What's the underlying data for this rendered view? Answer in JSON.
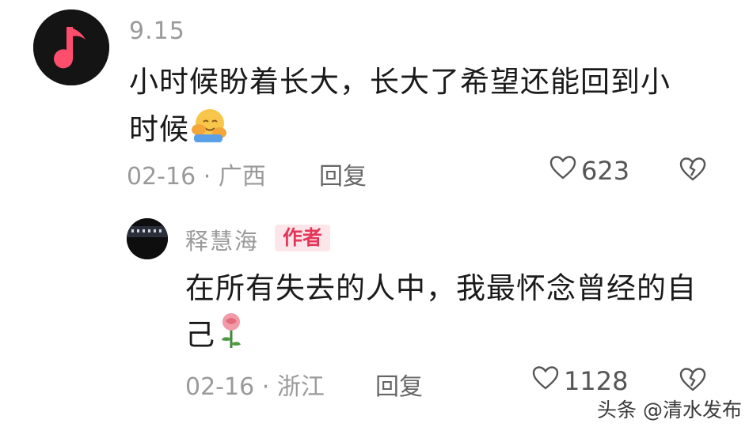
{
  "comments": [
    {
      "username": "9.15",
      "text": "小时候盼着长大，长大了希望还能回到小时候",
      "emoji": "hugging-face-emoji",
      "date": "02-16",
      "separator": "·",
      "location": "广西",
      "reply_label": "回复",
      "likes": "623",
      "avatar_icon": "music-note-icon"
    },
    {
      "username": "释慧海",
      "badge": "作者",
      "text": "在所有失去的人中，我最怀念曾经的自己",
      "emoji": "rose-emoji",
      "date": "02-16",
      "separator": "·",
      "location": "浙江",
      "reply_label": "回复",
      "likes": "1128"
    }
  ],
  "watermark": "头条 @清水发布",
  "colors": {
    "badge_bg": "#fde6ea",
    "badge_text": "#e5365a",
    "avatar_note": "#ff4d6d",
    "meta_gray": "#9a9a9a"
  }
}
